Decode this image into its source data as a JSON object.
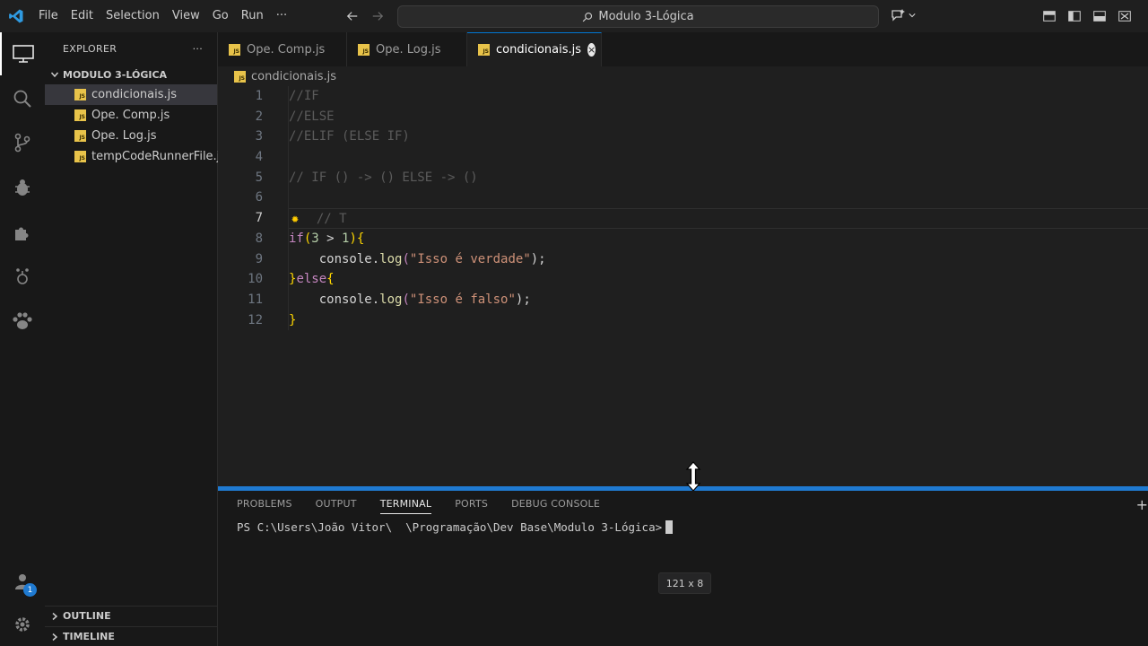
{
  "titlebar": {
    "menu": [
      "File",
      "Edit",
      "Selection",
      "View",
      "Go",
      "Run",
      "···"
    ],
    "search": "Modulo 3-Lógica"
  },
  "activitybar": {
    "items": [
      "explorer-icon",
      "search-icon",
      "source-control-icon",
      "run-debug-icon",
      "extensions-icon",
      "testing-icon",
      "paw-icon"
    ],
    "accounts_badge": "1"
  },
  "sidebar": {
    "title": "EXPLORER",
    "more": "···",
    "folder": "MODULO 3-LÓGICA",
    "files": [
      "condicionais.js",
      "Ope. Comp.js",
      "Ope. Log.js",
      "tempCodeRunnerFile.js"
    ],
    "outline": "OUTLINE",
    "timeline": "TIMELINE"
  },
  "tabs": [
    {
      "label": "Ope. Comp.js"
    },
    {
      "label": "Ope. Log.js"
    },
    {
      "label": "condicionais.js",
      "active": true
    }
  ],
  "breadcrumb": "condicionais.js",
  "editor": {
    "line_numbers": [
      "1",
      "2",
      "3",
      "4",
      "5",
      "6",
      "7",
      "8",
      "9",
      "10",
      "11",
      "12"
    ],
    "current_line": 7,
    "code": {
      "l1": "//IF",
      "l2": "//ELSE",
      "l3": "//ELIF (ELSE IF)",
      "l5": "// IF () -> () ELSE -> ()",
      "l7": "// T",
      "l8_kw": "if",
      "l8_open": "(",
      "l8_a": "3",
      "l8_op": " > ",
      "l8_b": "1",
      "l8_close": ")",
      "l8_brace": "{",
      "l9_obj": "console.",
      "l9_fn": "log",
      "l9_open": "(",
      "l9_str": "\"Isso é verdade\"",
      "l9_close": ");",
      "l10_brace1": "}",
      "l10_kw": "else",
      "l10_brace2": "{",
      "l11_obj": "console.",
      "l11_fn": "log",
      "l11_open": "(",
      "l11_str": "\"Isso é falso\"",
      "l11_close": ");",
      "l12": "}"
    }
  },
  "panel": {
    "tabs": [
      "PROBLEMS",
      "OUTPUT",
      "TERMINAL",
      "PORTS",
      "DEBUG CONSOLE"
    ],
    "active_tab": "TERMINAL",
    "prompt": "PS C:\\Users\\João Vitor\\  \\Programação\\Dev Base\\Modulo 3-Lógica>",
    "size_tooltip": "121 x 8",
    "plus": "+"
  },
  "colors": {
    "accent": "#0078d4",
    "js_icon": "#e8c34a"
  }
}
